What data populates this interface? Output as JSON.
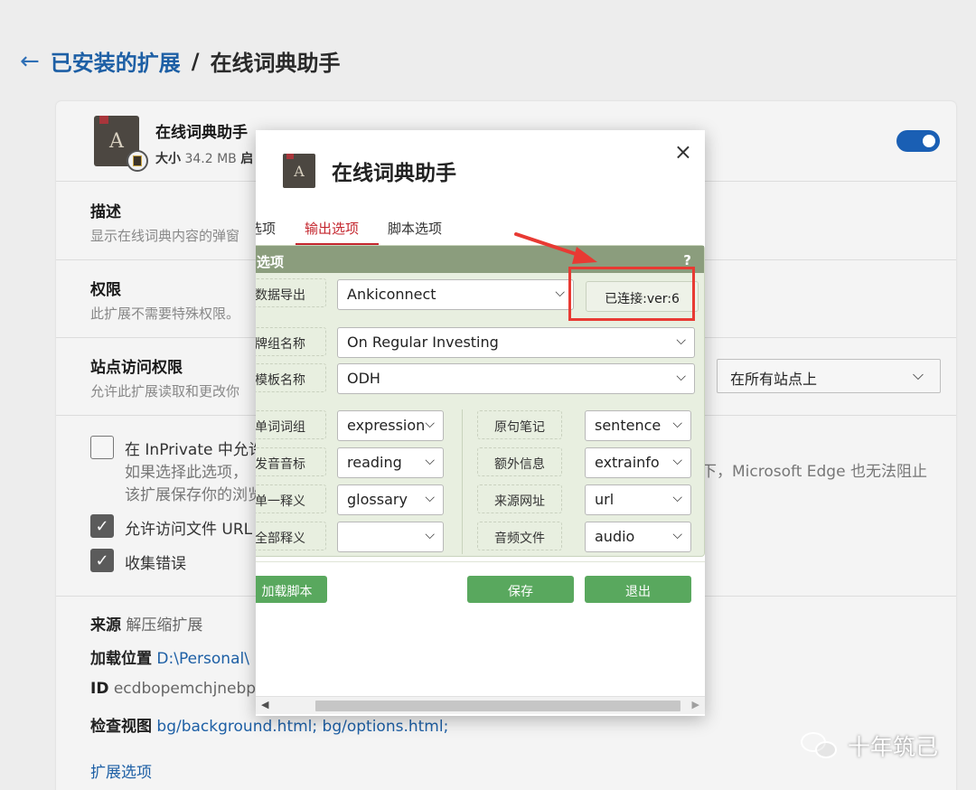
{
  "header": {
    "back_icon": "←",
    "breadcrumb_parent": "已安装的扩展",
    "separator": "/",
    "breadcrumb_current": "在线词典助手"
  },
  "extension": {
    "name": "在线词典助手",
    "size_label": "大小",
    "size_value": "34.2 MB",
    "size_tail": "启",
    "enabled": true
  },
  "sections": {
    "description_title": "描述",
    "description_text": "显示在线词典内容的弹窗",
    "permissions_title": "权限",
    "permissions_text": "此扩展不需要特殊权限。",
    "site_access_title": "站点访问权限",
    "site_access_text": "允许此扩展读取和更改你",
    "site_access_value": "在所有站点上"
  },
  "checkboxes": {
    "inprivate_label": "在 InPrivate 中允许",
    "inprivate_sub1": "如果选择此选项，",
    "inprivate_sub2": "该扩展保存你的浏览",
    "edge_warning": "下，Microsoft Edge 也无法阻止",
    "file_url_label": "允许访问文件 URL",
    "errors_label": "收集错误"
  },
  "meta": {
    "source_label": "来源",
    "source_value": "解压缩扩展",
    "location_label": "加载位置",
    "location_value": "D:\\Personal\\",
    "id_label": "ID",
    "id_value": "ecdbopemchjnebp",
    "inspect_label": "检查视图",
    "inspect_links": "bg/background.html;  bg/options.html;",
    "options_link": "扩展选项"
  },
  "modal": {
    "title": "在线词典助手",
    "close_icon": "×",
    "tabs": [
      "选项",
      "输出选项",
      "脚本选项"
    ],
    "active_tab": 1,
    "panel_title": "选项",
    "help_icon": "?",
    "export_label": "数据导出",
    "export_value": "Ankiconnect",
    "status_text": "已连接:ver:6",
    "deck_label": "牌组名称",
    "deck_value": "On Regular Investing",
    "model_label": "模板名称",
    "model_value": "ODH",
    "fields_left": [
      {
        "label": "单词词组",
        "value": "expression"
      },
      {
        "label": "发音音标",
        "value": "reading"
      },
      {
        "label": "单一释义",
        "value": "glossary"
      },
      {
        "label": "全部释义",
        "value": ""
      }
    ],
    "fields_right": [
      {
        "label": "原句笔记",
        "value": "sentence"
      },
      {
        "label": "额外信息",
        "value": "extrainfo"
      },
      {
        "label": "来源网址",
        "value": "url"
      },
      {
        "label": "音频文件",
        "value": "audio"
      }
    ],
    "load_script_button": "加载脚本",
    "save_button": "保存",
    "exit_button": "退出"
  },
  "watermark": {
    "text": "十年筑己",
    "icon": "wechat-icon"
  },
  "colors": {
    "accent_blue": "#1d5fa5",
    "tab_active_red": "#c4262e",
    "panel_header": "#8b9d7d",
    "button_green": "#59a85e",
    "highlight_red": "#e83a33"
  }
}
